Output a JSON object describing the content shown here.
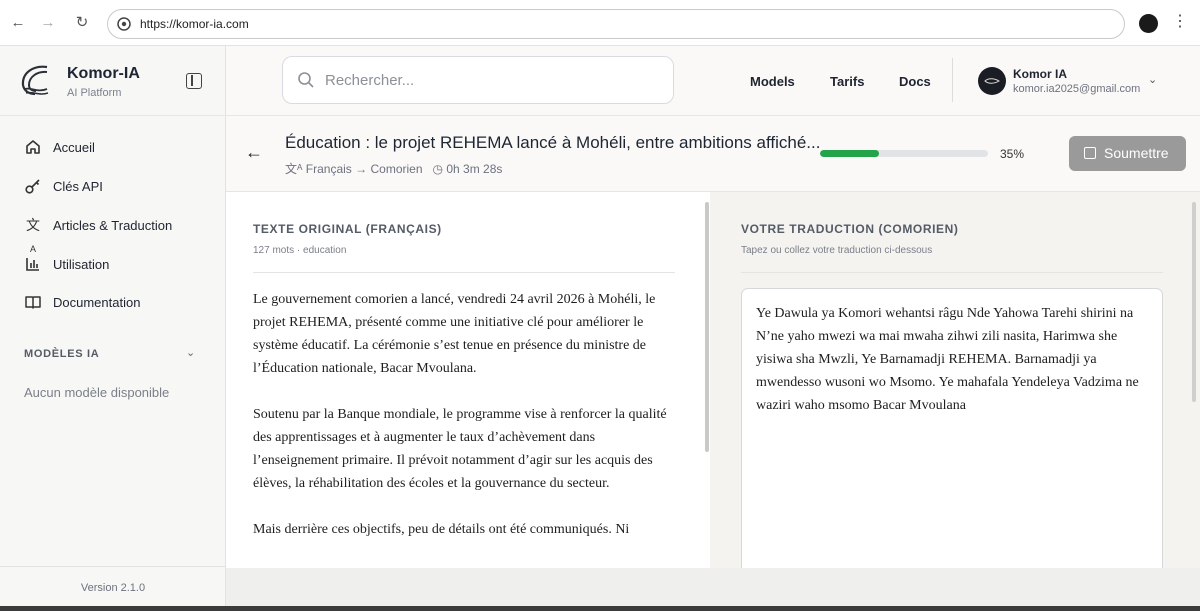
{
  "browser": {
    "url": "https://komor-ia.com"
  },
  "sidebar": {
    "brand_name": "Komor-IA",
    "brand_sub": "AI Platform",
    "items": [
      {
        "label": "Accueil",
        "icon": "home-icon"
      },
      {
        "label": "Clés API",
        "icon": "key-icon"
      },
      {
        "label": "Articles & Traduction",
        "icon": "translate-icon"
      },
      {
        "label": "Utilisation",
        "icon": "bar-chart-icon"
      },
      {
        "label": "Documentation",
        "icon": "book-icon"
      }
    ],
    "section_title": "MODÈLES IA",
    "no_models": "Aucun modèle disponible",
    "version": "Version 2.1.0"
  },
  "header": {
    "search_placeholder": "Rechercher...",
    "links": [
      "Models",
      "Tarifs",
      "Docs"
    ],
    "user_name": "Komor IA",
    "user_email": "komor.ia2025@gmail.com"
  },
  "article": {
    "title": "Éducation : le projet REHEMA lancé à Mohéli, entre ambitions affiché...",
    "lang": "Français → Comorien",
    "time": "0h 3m 28s",
    "progress": 0.35,
    "progress_label": "35%",
    "submit_label": "Soumettre"
  },
  "original": {
    "heading": "TEXTE ORIGINAL (FRANÇAIS)",
    "meta": "127 mots · education",
    "paragraphs": [
      "Le gouvernement comorien a lancé, vendredi 24 avril 2026 à Mohéli, le projet REHEMA, présenté comme une initiative clé pour améliorer le système éducatif. La cérémonie s’est tenue en présence du ministre de l’Éducation nationale, Bacar Mvoulana.",
      "Soutenu par la Banque mondiale, le programme vise à renforcer la qualité des apprentissages et à augmenter le taux d’achèvement dans l’enseignement primaire. Il prévoit notamment d’agir sur les acquis des élèves, la réhabilitation des écoles et la gouvernance du secteur.",
      "Mais derrière ces objectifs, peu de détails ont été communiqués. Ni"
    ]
  },
  "translation": {
    "heading": "VOTRE TRADUCTION (COMORIEN)",
    "sub": "Tapez ou collez votre traduction ci-dessous",
    "text": "Ye Dawula ya Komori wehantsi râgu Nde Yahowa Tarehi shirini na N’ne yaho mwezi wa mai  mwaha zihwi zili nasita, Harimwa she yisiwa sha Mwzli, Ye Barnamadji REHEMA. Barnamadji ya mwendesso wusoni wo Msomo. Ye mahafala Yendeleya Vadzima ne waziri waho msomo Bacar Mvoulana"
  },
  "colors": {
    "progress": "#23a34a",
    "submit_disabled": "#9a9a9a"
  }
}
